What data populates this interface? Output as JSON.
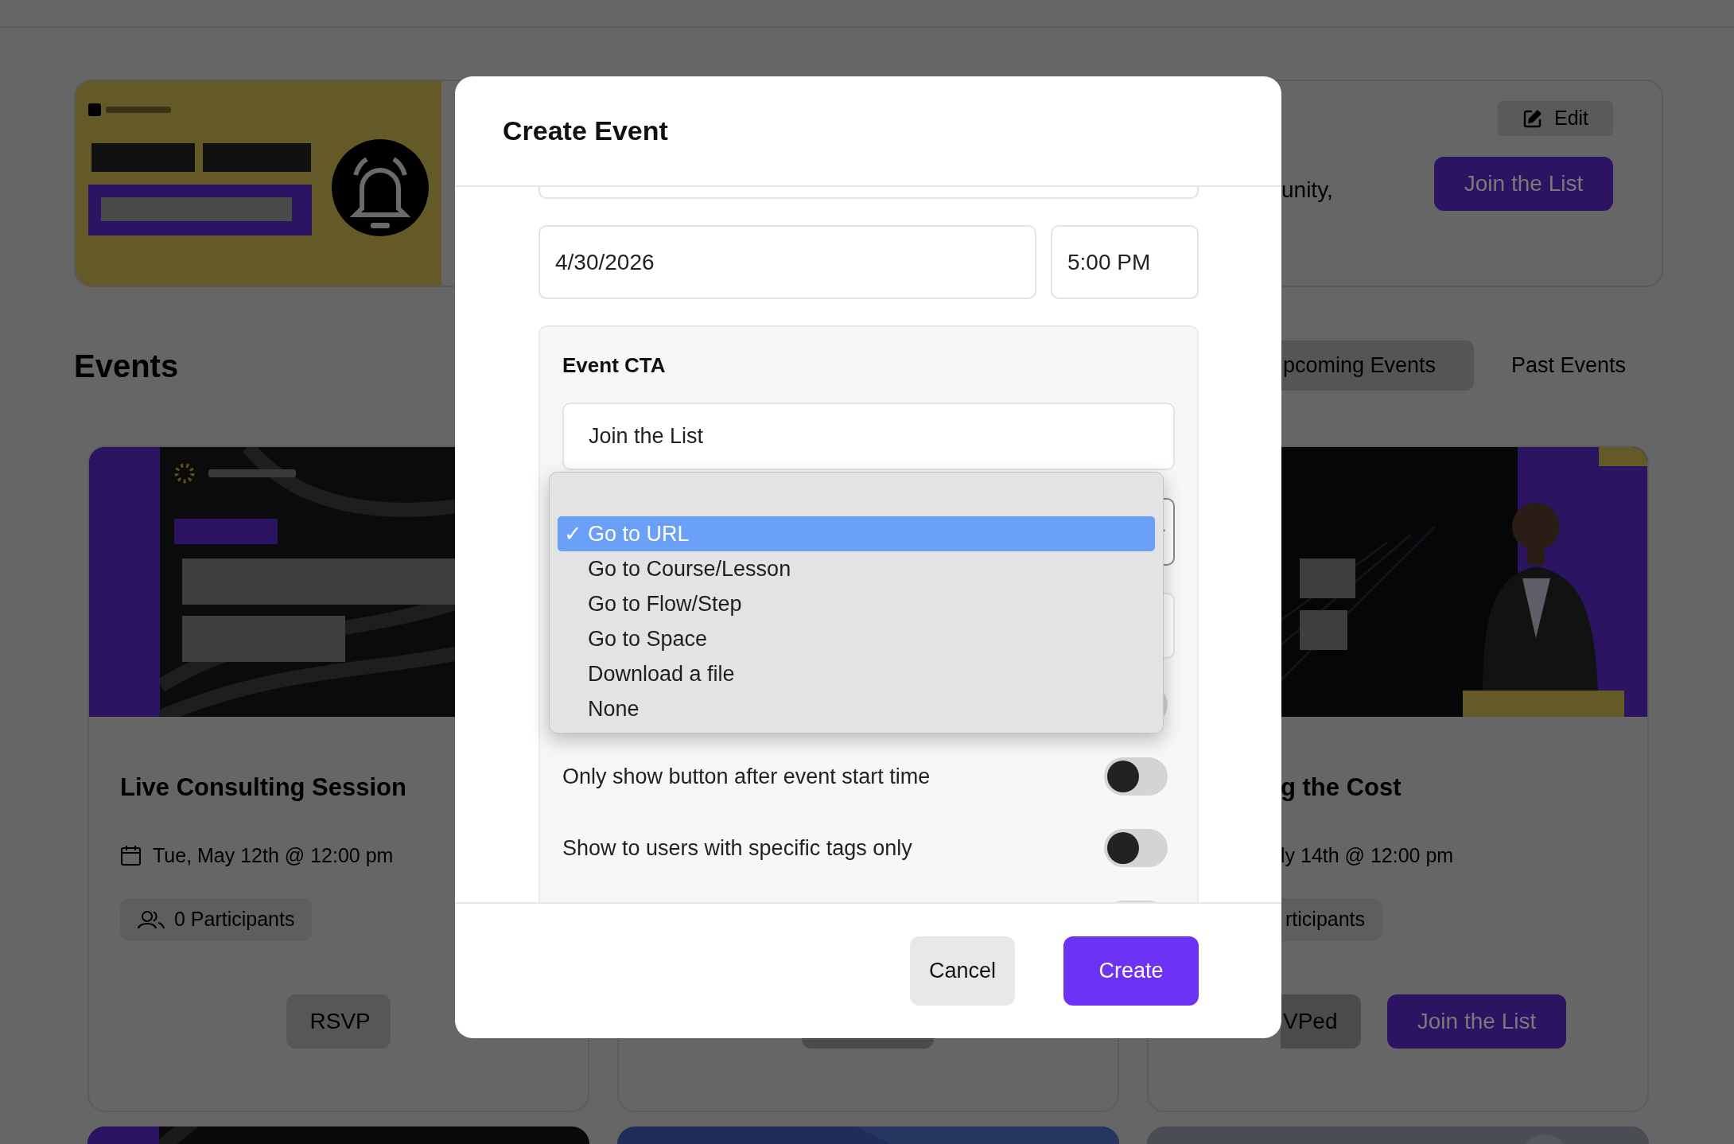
{
  "header_banner": {
    "picture": {
      "kind": "picture"
    },
    "description": "unity,",
    "edit_button": "Edit",
    "cta_button": "Join the List"
  },
  "events_heading": "Events",
  "event_tabs": [
    {
      "label": "pcoming Events",
      "selected": true
    },
    {
      "label": "Past Events",
      "selected": false
    }
  ],
  "event_cards": [
    {
      "image": {
        "kind": "picture"
      },
      "title": "Live Consulting Session",
      "date": "Tue, May 12th @ 12:00 pm",
      "participants": "0 Participants",
      "buttons": [
        {
          "label": "RSVP",
          "kind": "secondary"
        }
      ]
    },
    {
      "buttons": [
        {
          "kind": "dark"
        }
      ]
    },
    {
      "image": {
        "kind": "picture"
      },
      "title": "g the Cost",
      "date": "ly 14th @ 12:00 pm",
      "participants": "rticipants",
      "buttons": [
        {
          "label": "VPed",
          "kind": "dark"
        },
        {
          "label": "Join the List",
          "kind": "primary"
        }
      ]
    }
  ],
  "next_row_cards": [
    {
      "kind": "picture"
    },
    {
      "kind": "picture"
    },
    {
      "kind": "picture"
    }
  ],
  "modal": {
    "title": "Create Event",
    "date_field": {
      "value": "4/30/2026"
    },
    "time_field": {
      "value": "5:00 PM"
    },
    "cta_panel": {
      "heading": "Event CTA",
      "button_text_field": {
        "value": "Join the List"
      },
      "toggles": [
        {
          "kind": "covered",
          "on": false
        },
        {
          "kind": "labeled",
          "label": "Only show button after event start time",
          "on": false
        },
        {
          "kind": "labeled",
          "label": "Show to users with specific tags only",
          "on": false
        },
        {
          "kind": "covered",
          "on": false
        }
      ]
    },
    "buttons": [
      {
        "label": "Cancel",
        "kind": "secondary"
      },
      {
        "label": "Create",
        "kind": "primary"
      }
    ]
  },
  "cta_action_menu": {
    "check": "✓",
    "options": [
      {
        "label": "Go to URL",
        "selected": true
      },
      {
        "label": "Go to Course/Lesson",
        "selected": false
      },
      {
        "label": "Go to Flow/Step",
        "selected": false
      },
      {
        "label": "Go to Space",
        "selected": false
      },
      {
        "label": "Download a file",
        "selected": false
      },
      {
        "label": "None",
        "selected": false
      }
    ]
  }
}
